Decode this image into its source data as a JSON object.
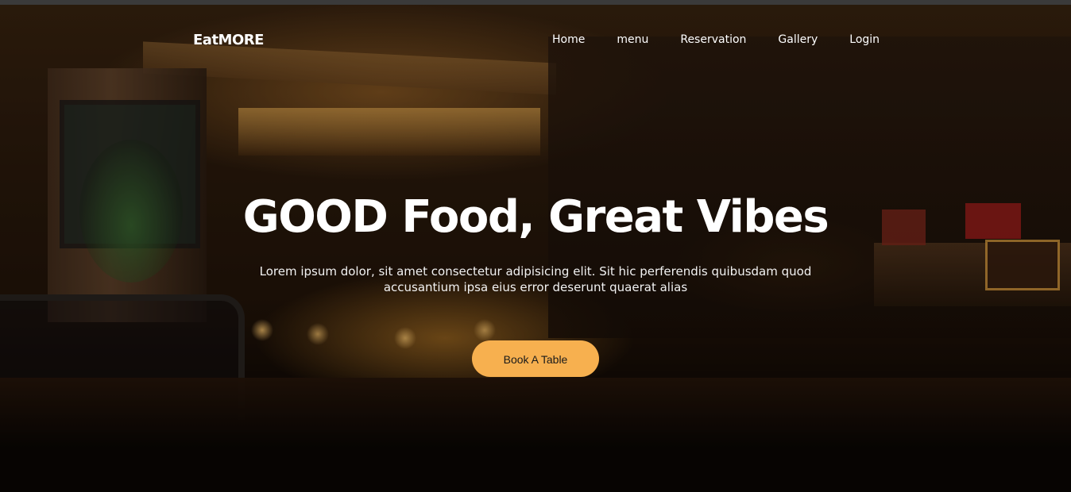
{
  "navbar": {
    "brand": "EatMORE",
    "links": [
      {
        "label": "Home"
      },
      {
        "label": "menu"
      },
      {
        "label": "Reservation"
      },
      {
        "label": "Gallery"
      },
      {
        "label": "Login"
      }
    ]
  },
  "hero": {
    "title": "GOOD Food, Great Vibes",
    "text": "Lorem ipsum dolor, sit amet consectetur adipisicing elit. Sit hic perferendis quibusdam quod accusantium ipsa eius error deserunt quaerat alias",
    "button_label": "Book A Table"
  },
  "colors": {
    "accent": "#f7b04f",
    "text": "#ffffff"
  }
}
